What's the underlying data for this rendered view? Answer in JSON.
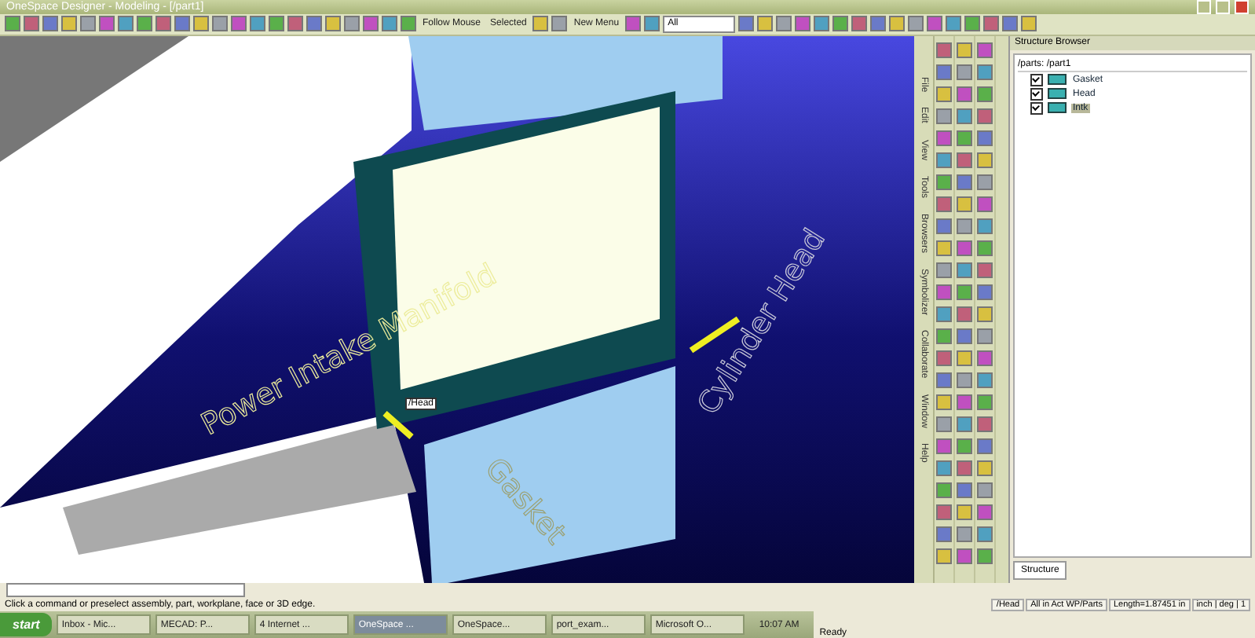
{
  "window": {
    "title": "OneSpace Designer - Modeling - [/part1]"
  },
  "toolbar": {
    "follow_mouse": "Follow Mouse",
    "selection": "Selected",
    "menu": "New Menu",
    "filter": "All"
  },
  "menu_tabs": [
    {
      "label": "File"
    },
    {
      "label": "Edit"
    },
    {
      "label": "View"
    },
    {
      "label": "Tools"
    },
    {
      "label": "Browsers"
    },
    {
      "label": "Symbolizer"
    },
    {
      "label": "Collaborate"
    },
    {
      "label": "Window"
    },
    {
      "label": "Help"
    }
  ],
  "viewport": {
    "labels": [
      {
        "kind": "manifold",
        "text": "Power Intake Manifold"
      },
      {
        "kind": "head",
        "text": "Cylinder Head"
      },
      {
        "kind": "gasket",
        "text": "Gasket"
      }
    ],
    "tooltip": "/Head"
  },
  "structure_browser": {
    "title": "Structure Browser",
    "root": "/parts: /part1",
    "tab": "Structure",
    "items": [
      {
        "label": "Gasket",
        "checked": true,
        "selected": false
      },
      {
        "label": "Head",
        "checked": true,
        "selected": false
      },
      {
        "label": "Intk",
        "checked": true,
        "selected": true
      }
    ]
  },
  "command_prompt": "Click a command or preselect assembly, part, workplane, face or 3D edge.",
  "status_bar": {
    "fields": [
      "/Head",
      "All in Act WP/Parts",
      "Length=1.87451 in",
      "inch | deg | 1"
    ],
    "message": "Ready"
  },
  "taskbar": {
    "start": "start",
    "tasks": [
      {
        "label": "Inbox - Mic...",
        "selected": false
      },
      {
        "label": "MECAD: P...",
        "selected": false
      },
      {
        "label": "4 Internet ...",
        "selected": false
      },
      {
        "label": "OneSpace ...",
        "selected": true
      },
      {
        "label": "OneSpace...",
        "selected": false
      },
      {
        "label": "port_exam...",
        "selected": false
      },
      {
        "label": "Microsoft O...",
        "selected": false
      }
    ],
    "clock": "10:07 AM"
  }
}
